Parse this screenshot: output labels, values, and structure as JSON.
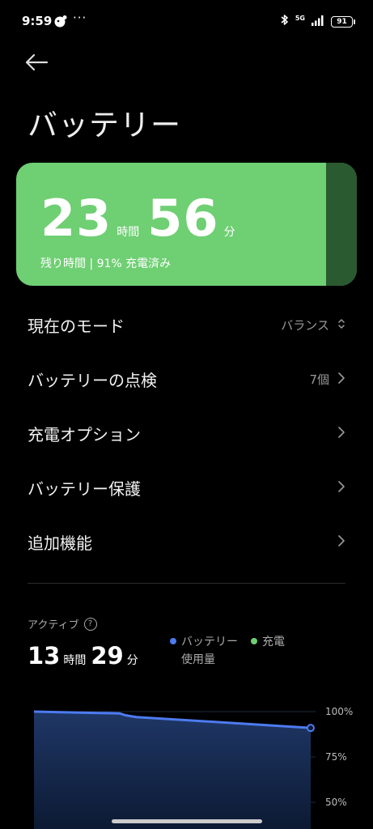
{
  "status_bar": {
    "time": "9:59",
    "dots": "···",
    "network": "5G",
    "battery": "91"
  },
  "page": {
    "title": "バッテリー"
  },
  "battery_card": {
    "hours": "23",
    "hours_unit": "時間",
    "minutes": "56",
    "minutes_unit": "分",
    "subtitle": "残り時間 | 91% 充電済み",
    "level_percent": 91,
    "fill_color": "#6fcf73",
    "empty_color": "#2a5a2f"
  },
  "settings": {
    "items": [
      {
        "label": "現在のモード",
        "value": "バランス",
        "icon": "updown-icon"
      },
      {
        "label": "バッテリーの点検",
        "value": "7個",
        "icon": "chevron-right-icon"
      },
      {
        "label": "充電オプション",
        "value": "",
        "icon": "chevron-right-icon"
      },
      {
        "label": "バッテリー保護",
        "value": "",
        "icon": "chevron-right-icon"
      },
      {
        "label": "追加機能",
        "value": "",
        "icon": "chevron-right-icon"
      }
    ]
  },
  "usage": {
    "active_label": "アクティブ",
    "help_glyph": "?",
    "hours": "13",
    "hours_unit": "時間",
    "minutes": "29",
    "minutes_unit": "分"
  },
  "legend": {
    "usage_line1": "バッテリー",
    "usage_line2": "使用量",
    "usage_color": "#4d7bf0",
    "charge": "充電",
    "charge_color": "#6fcf73"
  },
  "chart_data": {
    "type": "area",
    "x": [
      0,
      0.31,
      0.33,
      0.37,
      1.0
    ],
    "y": [
      100,
      99,
      98,
      97,
      91
    ],
    "ylim": [
      50,
      100
    ],
    "yticks": [
      "100%",
      "75%",
      "50%"
    ],
    "ytick_values": [
      100,
      75,
      50
    ],
    "line_color": "#4d7bf0"
  }
}
